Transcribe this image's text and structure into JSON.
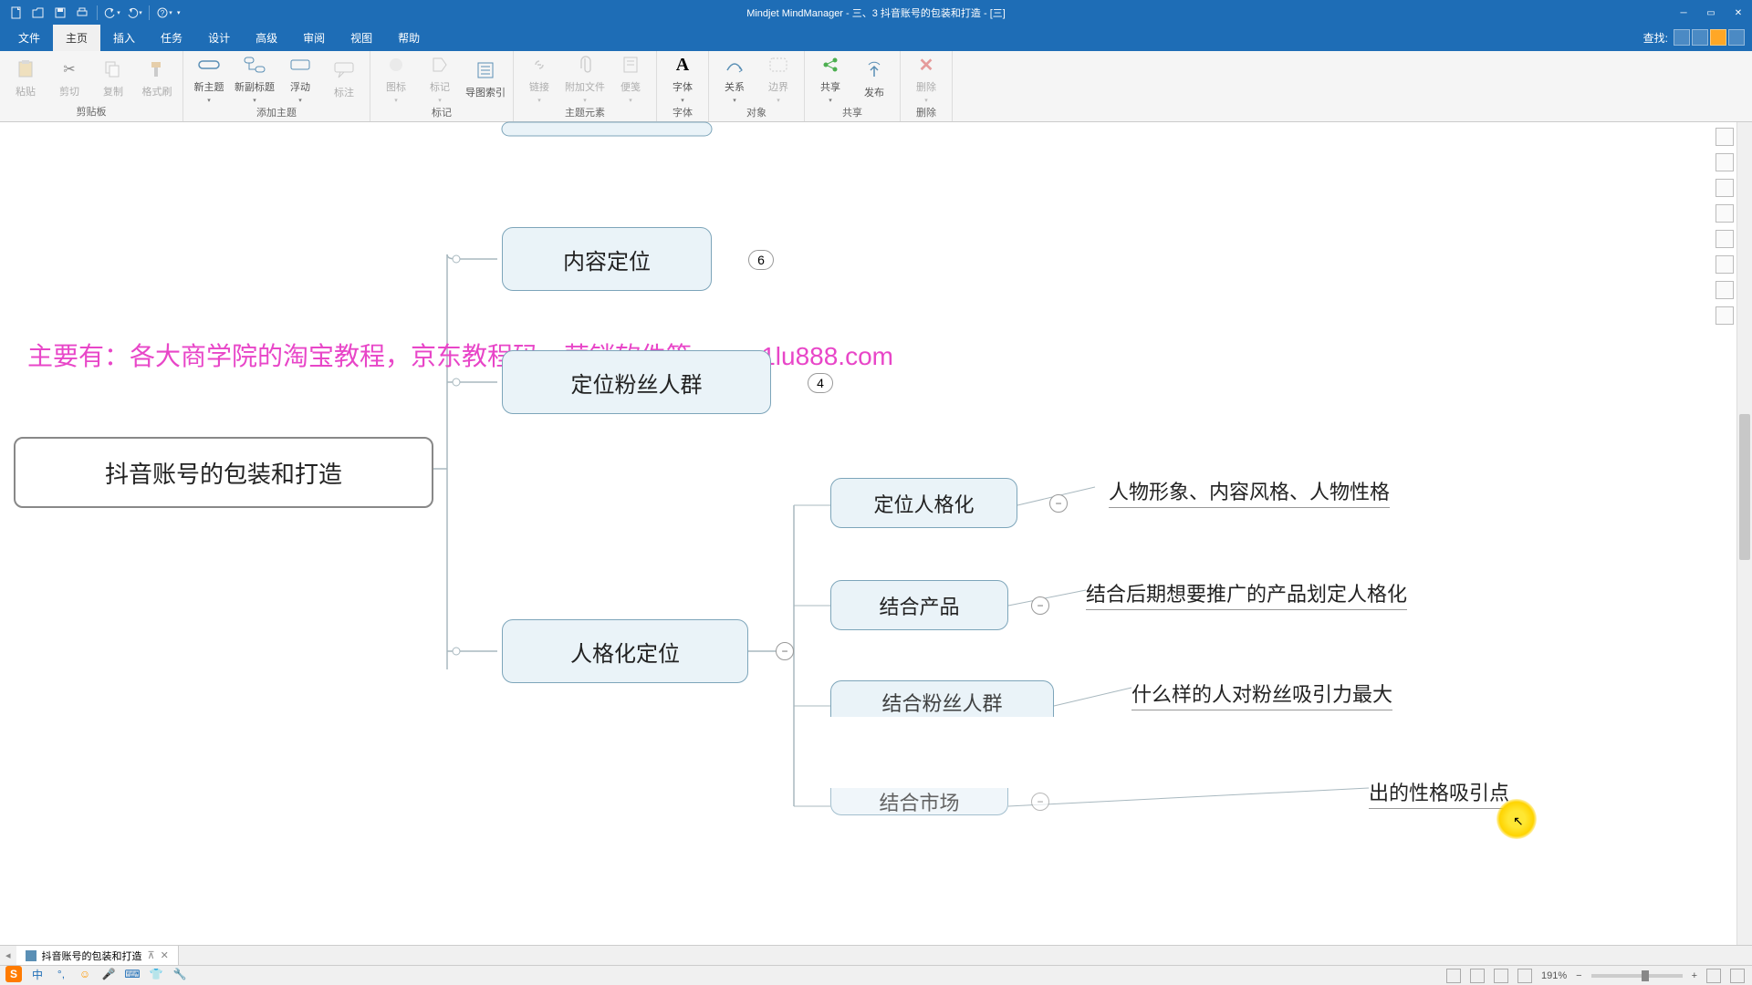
{
  "app": {
    "title": "Mindjet MindManager - 三、3 抖音账号的包装和打造 - [三]"
  },
  "qat": {
    "new": "new",
    "open": "open",
    "save": "save",
    "print": "print",
    "undo": "undo",
    "redo": "redo",
    "help": "help"
  },
  "tabs": {
    "items": [
      "文件",
      "主页",
      "插入",
      "任务",
      "设计",
      "高级",
      "审阅",
      "视图",
      "帮助"
    ],
    "active": 1,
    "search": "查找:"
  },
  "ribbon": {
    "groups": {
      "clipboard": {
        "label": "剪贴板",
        "paste": "粘贴",
        "cut": "剪切",
        "copy": "复制",
        "format": "格式刷"
      },
      "addtopic": {
        "label": "添加主题",
        "newtopic": "新主题",
        "newsubtopic": "新副标题",
        "floating": "浮动",
        "callout": "标注"
      },
      "marker": {
        "label": "标记",
        "icon": "图标",
        "tag": "标记",
        "index": "导图索引"
      },
      "topicelem": {
        "label": "主题元素",
        "link": "链接",
        "attach": "附加文件",
        "note": "便笺"
      },
      "font": {
        "label": "字体",
        "btn": "字体"
      },
      "object": {
        "label": "对象",
        "relation": "关系",
        "boundary": "边界"
      },
      "share": {
        "label": "共享",
        "share": "共享",
        "publish": "发布"
      },
      "delete": {
        "label": "删除",
        "btn": "删除"
      }
    }
  },
  "mindmap": {
    "root": "抖音账号的包装和打造",
    "n1": {
      "label": "内容定位",
      "badge": "6"
    },
    "n2": {
      "label": "定位粉丝人群",
      "badge": "4"
    },
    "n3": {
      "label": "人格化定位"
    },
    "n3a": {
      "label": "定位人格化",
      "leaf": "人物形象、内容风格、人物性格"
    },
    "n3b": {
      "label": "结合产品",
      "leaf": "结合后期想要推广的产品划定人格化"
    },
    "n3c": {
      "label": "结合粉丝人群",
      "leaf": "什么样的人对粉丝吸引力最大"
    },
    "n3d": {
      "label": "结合市场",
      "leaf": "出的性格吸引点"
    }
  },
  "watermark": "主要有：各大商学院的淘宝教程，京东教程码，营销软件等-www.1lu888.com",
  "doctab": {
    "name": "抖音账号的包装和打造"
  },
  "status": {
    "zoom": "191%"
  },
  "taskbar": {
    "ime": "中"
  }
}
